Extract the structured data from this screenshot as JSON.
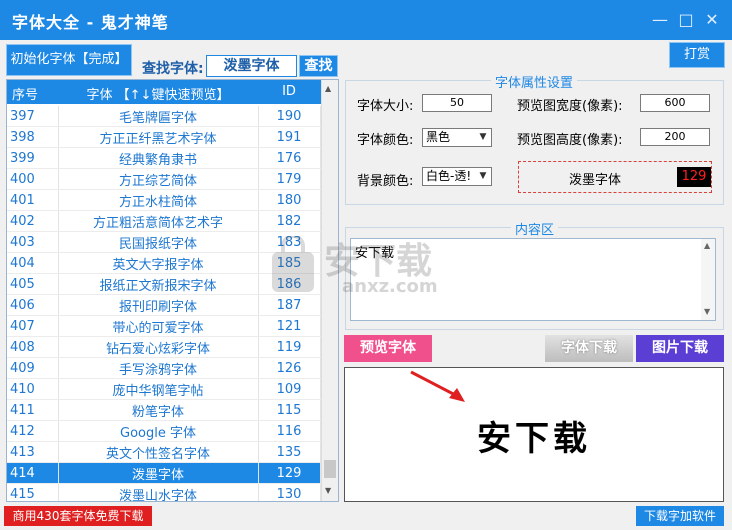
{
  "window": {
    "title": "字体大全 - 鬼才神笔",
    "min_icon": "—",
    "max_icon": "□",
    "close_icon": "✕"
  },
  "toolbar": {
    "init_button": "初始化字体【完成】",
    "find_label": "查找字体:",
    "find_value": "泼墨字体",
    "find_button": "查找",
    "reward_button": "打赏"
  },
  "table": {
    "headers": [
      "序号",
      "字体 【↑↓键快速预览】",
      "ID"
    ],
    "rows": [
      [
        "397",
        "毛笔牌匾字体",
        "190"
      ],
      [
        "398",
        "方正正纤黑艺术字体",
        "191"
      ],
      [
        "399",
        "经典繁角隶书",
        "176"
      ],
      [
        "400",
        "方正综艺简体",
        "179"
      ],
      [
        "401",
        "方正水柱简体",
        "180"
      ],
      [
        "402",
        "方正粗活意简体艺术字",
        "182"
      ],
      [
        "403",
        "民国报纸字体",
        "183"
      ],
      [
        "404",
        "英文大字报字体",
        "185"
      ],
      [
        "405",
        "报纸正文新报宋字体",
        "186"
      ],
      [
        "406",
        "报刊印刷字体",
        "187"
      ],
      [
        "407",
        "带心的可爱字体",
        "121"
      ],
      [
        "408",
        "钻石爱心炫彩字体",
        "119"
      ],
      [
        "409",
        "手写涂鸦字体",
        "126"
      ],
      [
        "410",
        "庞中华钢笔字帖",
        "109"
      ],
      [
        "411",
        "粉笔字体",
        "115"
      ],
      [
        "412",
        "Google 字体",
        "116"
      ],
      [
        "413",
        "英文个性签名字体",
        "135"
      ],
      [
        "414",
        "泼墨字体",
        "129"
      ],
      [
        "415",
        "泼墨山水字体",
        "130"
      ]
    ],
    "selected_index": 17
  },
  "properties": {
    "group_title": "字体属性设置",
    "size_label": "字体大小:",
    "size_value": "50",
    "width_label": "预览图宽度(像素):",
    "width_value": "600",
    "color_label": "字体颜色:",
    "color_value": "黑色",
    "height_label": "预览图高度(像素):",
    "height_value": "200",
    "bg_label": "背景颜色:",
    "bg_value": "白色-透!",
    "preview_name": "泼墨字体",
    "preview_id": "129"
  },
  "content": {
    "group_title": "内容区",
    "text": "安下载"
  },
  "actions": {
    "preview_button": "预览字体",
    "download_font_button": "字体下载",
    "download_image_button": "图片下载"
  },
  "preview": {
    "text": "安下载"
  },
  "footer": {
    "promo": "商用430套字体免费下载",
    "download_software": "下载字加软件"
  },
  "watermark": {
    "text": "安下载",
    "subtext": "anxz.com"
  },
  "colors": {
    "accent": "#1e88e5",
    "preview_button": "#f0508c",
    "image_button": "#5b3fd4",
    "promo": "#e02020",
    "id_box_bg": "#000000",
    "id_box_fg": "#ff2020",
    "arrow": "#e02020"
  }
}
